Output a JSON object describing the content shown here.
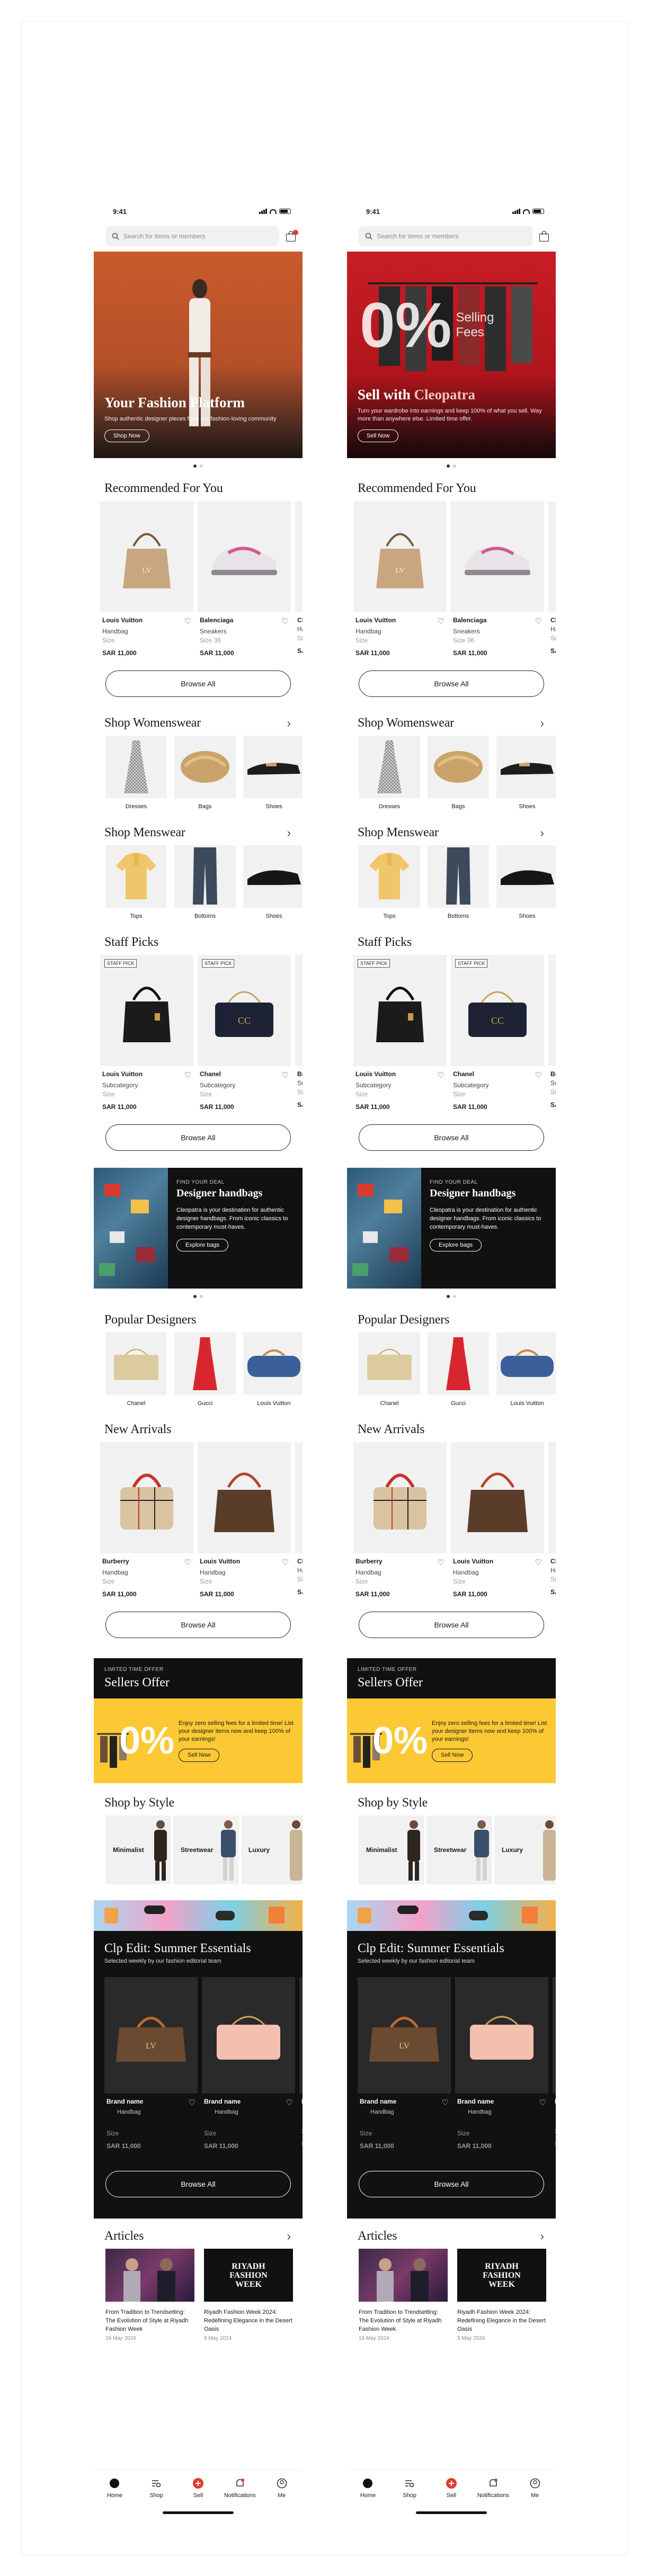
{
  "status": {
    "time": "9:41"
  },
  "search": {
    "placeholder": "Search for items or members"
  },
  "heroes": [
    {
      "title": "Your Fashion Platform",
      "title_accent": "",
      "body": "Shop authentic designer pieces from our fashion-loving community",
      "cta": "Shop Now"
    },
    {
      "title": "Sell with ",
      "title_accent": "Cleopatra",
      "body": "Turn your wardrobe into earnings and keep 100% of what you sell. Way more than anywhere else. Limited time offer.",
      "cta": "Sell Now",
      "overlay_big": "0%",
      "overlay_small_1": "Selling",
      "overlay_small_2": "Fees"
    }
  ],
  "recommended": {
    "title": "Recommended For You",
    "items": [
      {
        "brand": "Louis Vuitton",
        "sub": "Handbag",
        "size": "Size",
        "price": "SAR 11,000"
      },
      {
        "brand": "Balenciaga",
        "sub": "Sneakers",
        "size": "Size 36",
        "price": "SAR 11,000"
      },
      {
        "brand": "Ch",
        "sub": "Ha",
        "size": "Siz",
        "price": "SA"
      }
    ],
    "browse": "Browse All"
  },
  "womenswear": {
    "title": "Shop Womenswear",
    "items": [
      {
        "label": "Dresses"
      },
      {
        "label": "Bags"
      },
      {
        "label": "Shoes"
      }
    ]
  },
  "menswear": {
    "title": "Shop Menswear",
    "items": [
      {
        "label": "Tops"
      },
      {
        "label": "Bottoms"
      },
      {
        "label": "Shoes"
      }
    ]
  },
  "staff": {
    "title": "Staff Picks",
    "tag": "STAFF PICK",
    "items": [
      {
        "brand": "Louis Vuitton",
        "sub": "Subcategory",
        "size": "Size",
        "price": "SAR 11,000"
      },
      {
        "brand": "Chanel",
        "sub": "Subcategory",
        "size": "Size",
        "price": "SAR 11,000"
      },
      {
        "brand": "Br",
        "sub": "Su",
        "size": "Siz",
        "price": "SA"
      }
    ],
    "browse": "Browse All"
  },
  "promo": {
    "kicker": "FIND YOUR DEAL",
    "title": "Designer handbags",
    "body": "Cleopatra is your destination for authentic designer handbags. From iconic classics to contemporary must-haves.",
    "cta": "Explore bags"
  },
  "designers": {
    "title": "Popular Designers",
    "items": [
      {
        "label": "Chanel"
      },
      {
        "label": "Gucci"
      },
      {
        "label": "Louis Vuitton"
      }
    ]
  },
  "arrivals": {
    "title": "New Arrivals",
    "items": [
      {
        "brand": "Burberry",
        "sub": "Handbag",
        "size": "Size",
        "price": "SAR 11,000"
      },
      {
        "brand": "Louis Vuitton",
        "sub": "Handbag",
        "size": "Size",
        "price": "SAR 11,000"
      },
      {
        "brand": "Ch",
        "sub": "Ha",
        "size": "Siz",
        "price": "SA"
      }
    ],
    "browse": "Browse All"
  },
  "sellers": {
    "kicker": "LIMITED TIME OFFER",
    "title": "Sellers Offer",
    "big": "0%",
    "body": "Enjoy zero selling fees for a limited time! List your designer items now and keep 100% of your earnings!",
    "cta": "Sell Now"
  },
  "styles": {
    "title": "Shop by Style",
    "items": [
      {
        "label": "Minimalist"
      },
      {
        "label": "Streetwear"
      },
      {
        "label": "Luxury"
      }
    ]
  },
  "edit": {
    "title": "Clp Edit: Summer Essentials",
    "sub": "Selected weekly by our fashion editorial team",
    "items": [
      {
        "brand": "Brand name",
        "sub": "Handbag",
        "size": "Size",
        "price": "SAR 11,000"
      },
      {
        "brand": "Brand name",
        "sub": "Handbag",
        "size": "Size",
        "price": "SAR 11,000"
      },
      {
        "brand": "Br",
        "sub": "Ha",
        "size": "Si",
        "price": "SA"
      }
    ],
    "browse": "Browse All"
  },
  "articles": {
    "title": "Articles",
    "items": [
      {
        "title": "From Tradition to Trendsetting: The Evolution of Style at Riyadh Fashion Week",
        "date": "19 May 2024",
        "img_text": ""
      },
      {
        "title": "Riyadh Fashion Week 2024: Redefining Elegance in the Desert Oasis",
        "date": "5 May 2024",
        "img_text": "RIYADH FASHION WEEK"
      }
    ]
  },
  "tabs": [
    {
      "label": "Home",
      "icon": "home-icon"
    },
    {
      "label": "Shop",
      "icon": "shop-icon"
    },
    {
      "label": "Sell",
      "icon": "plus-circle-icon"
    },
    {
      "label": "Notifications",
      "icon": "bell-icon"
    },
    {
      "label": "Me",
      "icon": "user-icon"
    }
  ],
  "colors": {
    "accent": "#e23b2e",
    "promo_yellow": "#fcc934",
    "dark": "#111111"
  }
}
